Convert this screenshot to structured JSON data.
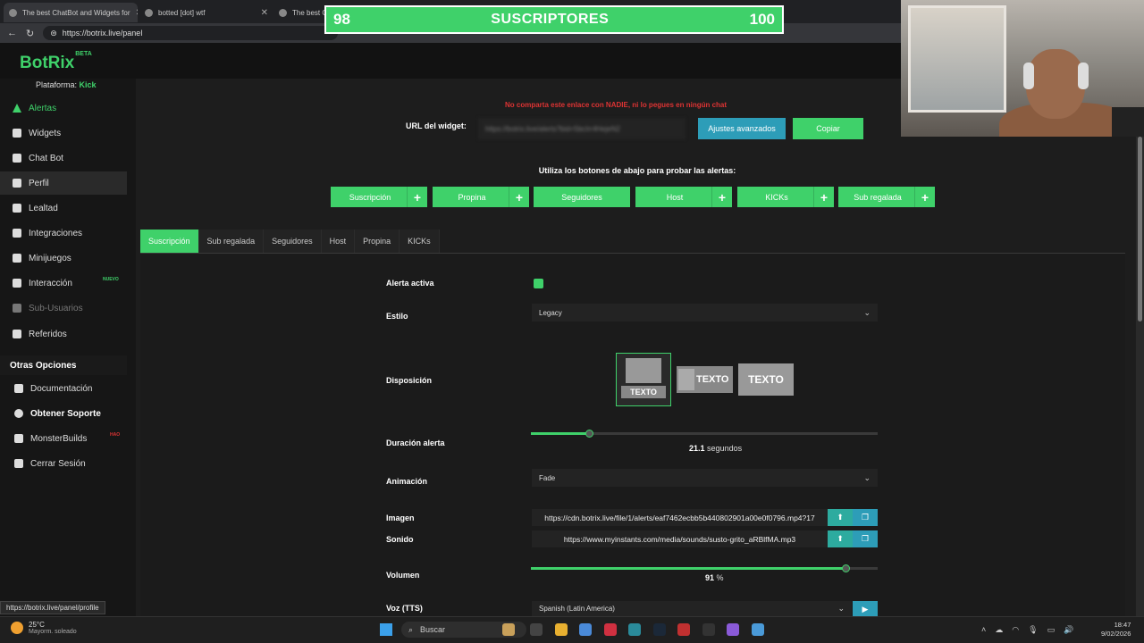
{
  "browser": {
    "tabs": [
      {
        "title": "The best ChatBot and Widgets for",
        "active": true
      },
      {
        "title": "botted [dot] wtf",
        "active": false
      },
      {
        "title": "The best Ch",
        "active": false
      }
    ],
    "url": "https://botrix.live/panel",
    "status_url": "https://botrix.live/panel/profile"
  },
  "overlay": {
    "current": "98",
    "label": "SUSCRIPTORES",
    "goal": "100"
  },
  "app": {
    "logo": "BotRix",
    "beta": "BETA",
    "platform_label": "Plataforma:",
    "platform_value": "Kick"
  },
  "sidebar": {
    "items": [
      {
        "label": "Alertas"
      },
      {
        "label": "Widgets"
      },
      {
        "label": "Chat Bot"
      },
      {
        "label": "Perfil"
      },
      {
        "label": "Lealtad"
      },
      {
        "label": "Integraciones"
      },
      {
        "label": "Minijuegos"
      },
      {
        "label": "Interacción",
        "badge": "NUEVO"
      },
      {
        "label": "Sub-Usuarios"
      },
      {
        "label": "Referidos"
      }
    ],
    "section": "Otras Opciones",
    "other": [
      {
        "label": "Documentación"
      },
      {
        "label": "Obtener Soporte"
      },
      {
        "label": "MonsterBuilds",
        "badge": "HAO"
      },
      {
        "label": "Cerrar Sesión"
      }
    ]
  },
  "widget": {
    "warning": "No comparta este enlace con NADIE, ni lo pegues en ningún chat",
    "url_label": "URL del widget:",
    "url_value": "https://botrix.live/alerts?bid=5bcIrr4HejeN2",
    "advanced": "Ajustes avanzados",
    "copy": "Copiar"
  },
  "test": {
    "label": "Utiliza los botones de abajo para probar las alertas:",
    "buttons": [
      "Suscripción",
      "Propina",
      "Seguidores",
      "Host",
      "KICKs",
      "Sub regalada"
    ]
  },
  "tabs": [
    "Suscripción",
    "Sub regalada",
    "Seguidores",
    "Host",
    "Propina",
    "KICKs"
  ],
  "form": {
    "active_label": "Alerta activa",
    "style_label": "Estilo",
    "style_value": "Legacy",
    "layout_label": "Disposición",
    "layout_text": "TEXTO",
    "duration_label": "Duración alerta",
    "duration_value": "21.1",
    "duration_unit": "segundos",
    "animation_label": "Animación",
    "animation_value": "Fade",
    "image_label": "Imagen",
    "image_value": "https://cdn.botrix.live/file/1/alerts/eaf7462ecbb5b440802901a00e0f0796.mp4?17",
    "sound_label": "Sonido",
    "sound_value": "https://www.myinstants.com/media/sounds/susto-grito_aRBlfMA.mp3",
    "volume_label": "Volumen",
    "volume_value": "91",
    "volume_unit": "%",
    "tts_label": "Voz (TTS)",
    "tts_value": "Spanish (Latin America)"
  },
  "taskbar": {
    "temp": "25°C",
    "weather": "Mayorm. soleado",
    "search": "Buscar",
    "time": "18:47",
    "date": "9/02/2026"
  }
}
